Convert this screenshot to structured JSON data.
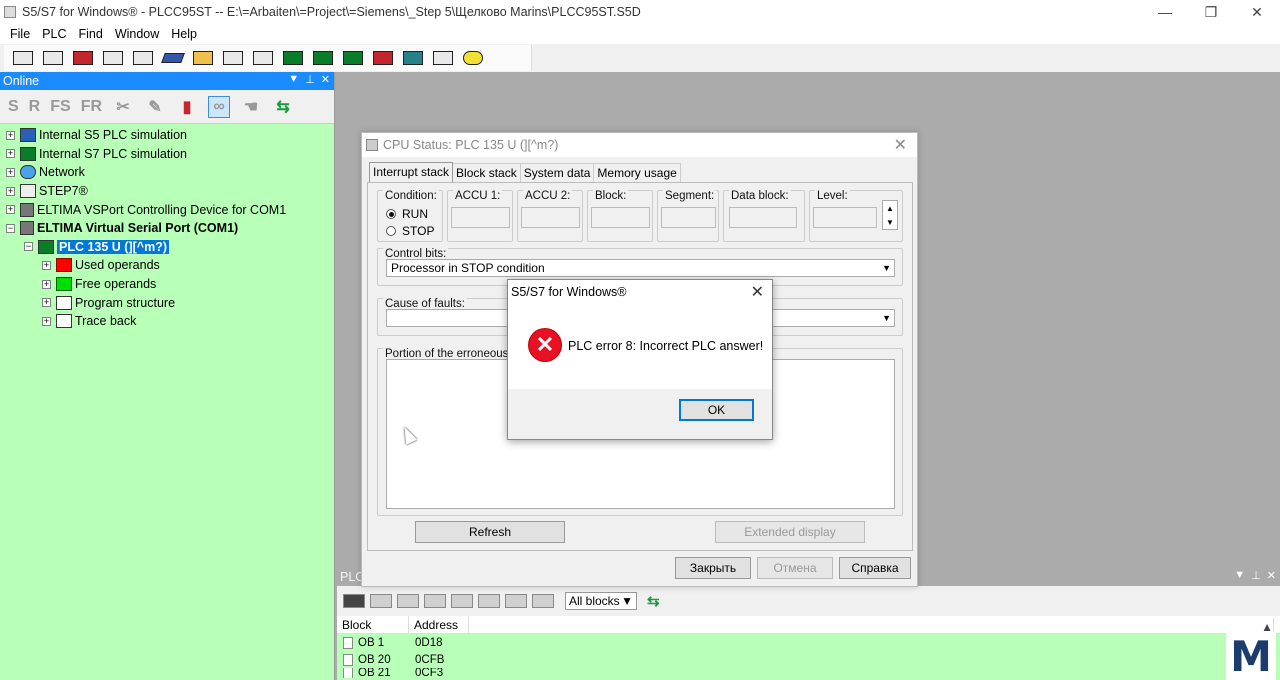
{
  "window": {
    "title": "S5/S7 for Windows® - PLCC95ST -- E:\\=Arbaiten\\=Project\\=Siemens\\_Step 5\\Щелково Marins\\PLCC95ST.S5D",
    "min_glyph": "—",
    "max_glyph": "❐",
    "close_glyph": "✕"
  },
  "menu": [
    "File",
    "PLC",
    "Find",
    "Window",
    "Help"
  ],
  "online": {
    "title": "Online",
    "tools": [
      "S",
      "R",
      "FS",
      "FR"
    ],
    "tree": [
      {
        "label": "Internal S5 PLC simulation",
        "icon": "plc-sim-icon"
      },
      {
        "label": "Internal S7 PLC simulation",
        "icon": "plc-sim-icon"
      },
      {
        "label": "Network",
        "icon": "network-icon"
      },
      {
        "label": "STEP7®",
        "icon": "step7-icon"
      },
      {
        "label": "ELTIMA VSPort Controlling Device for COM1",
        "icon": "serial-port-icon"
      },
      {
        "label": "ELTIMA Virtual Serial Port (COM1)",
        "icon": "serial-port-icon"
      },
      {
        "label": "PLC 135 U (][^m?)",
        "icon": "plc-icon"
      },
      {
        "label": "Used operands",
        "icon": "red-square-icon"
      },
      {
        "label": "Free operands",
        "icon": "green-square-icon"
      },
      {
        "label": "Program structure",
        "icon": "structure-icon"
      },
      {
        "label": "Trace back",
        "icon": "list-icon"
      }
    ]
  },
  "plc_window": {
    "title": "PLC",
    "filter_value": "All blocks",
    "columns": [
      "Block",
      "Address"
    ],
    "rows": [
      {
        "block": "OB 1",
        "address": "0D18"
      },
      {
        "block": "OB 20",
        "address": "0CFB"
      },
      {
        "block": "OB 21",
        "address": "0CF3"
      }
    ],
    "logo_text": "M"
  },
  "cpu_dialog": {
    "title": "CPU Status: PLC 135 U (][^m?)",
    "tabs": [
      "Interrupt stack",
      "Block stack",
      "System data",
      "Memory usage"
    ],
    "condition_label": "Condition:",
    "run_label": "RUN",
    "stop_label": "STOP",
    "accu1_label": "ACCU 1:",
    "accu2_label": "ACCU 2:",
    "block_label": "Block:",
    "segment_label": "Segment:",
    "datablock_label": "Data block:",
    "level_label": "Level:",
    "control_bits_label": "Control bits:",
    "control_bits_value": "Processor in STOP condition",
    "cause_label": "Cause of faults:",
    "cause_value": "",
    "portion_label": "Portion of the erroneous b",
    "refresh_label": "Refresh",
    "extended_label": "Extended display",
    "close_label": "Закрыть",
    "cancel_label": "Отмена",
    "help_label": "Справка"
  },
  "error_box": {
    "title": "S5/S7 for Windows®",
    "message": "PLC error 8: Incorrect PLC answer!",
    "ok_label": "OK"
  }
}
